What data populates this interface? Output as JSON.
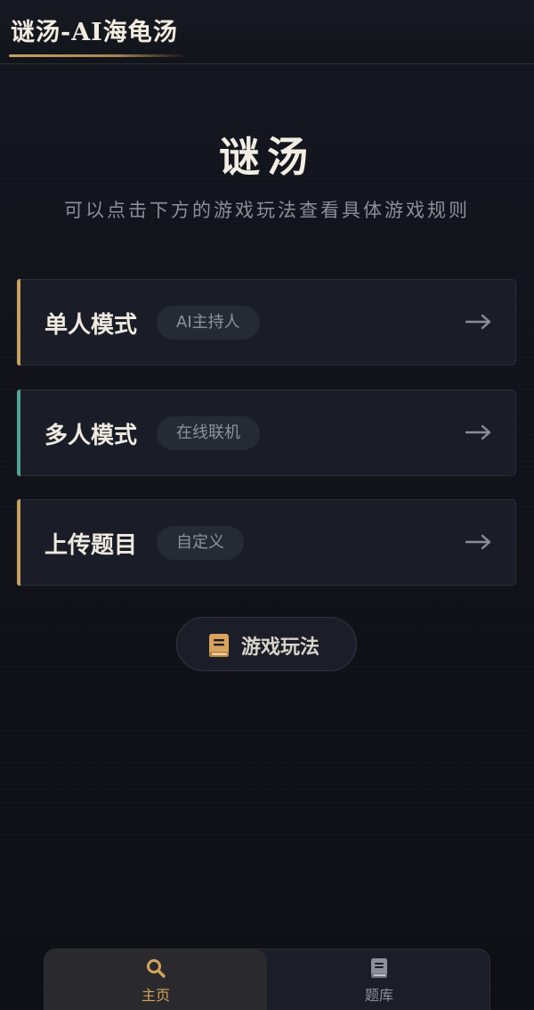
{
  "header": {
    "title": "谜汤-AI海龟汤"
  },
  "hero": {
    "title": "谜汤",
    "subtitle": "可以点击下方的游戏玩法查看具体游戏规则"
  },
  "modes": [
    {
      "name": "单人模式",
      "badge": "AI主持人",
      "accent_color": "#c9a15f",
      "icon": "arrow-right-icon"
    },
    {
      "name": "多人模式",
      "badge": "在线联机",
      "accent_color": "#4fa596",
      "icon": "arrow-right-icon"
    },
    {
      "name": "上传题目",
      "badge": "自定义",
      "accent_color": "#c9a15f",
      "icon": "arrow-right-icon"
    }
  ],
  "howto": {
    "label": "游戏玩法",
    "icon": "book-icon",
    "icon_color": "#d9a35c"
  },
  "nav": {
    "items": [
      {
        "label": "主页",
        "icon": "search-icon",
        "active": true,
        "color": "#d4a35a"
      },
      {
        "label": "题库",
        "icon": "book-icon",
        "active": false,
        "color": "#8d909a"
      }
    ]
  },
  "colors": {
    "gold": "#c9a15f",
    "teal": "#4fa596",
    "background": "#0e1016",
    "card": "#1a1d27"
  }
}
